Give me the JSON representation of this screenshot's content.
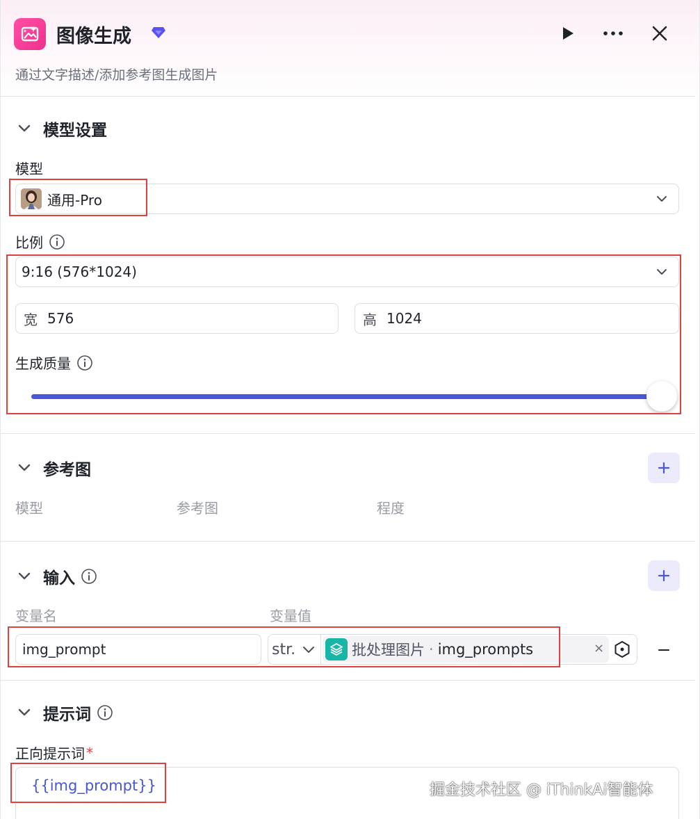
{
  "header": {
    "title": "图像生成",
    "subtitle": "通过文字描述/添加参考图生成图片",
    "app_icon": "image-sparkle-icon",
    "badge_icon": "diamond-icon",
    "actions": [
      "play-icon",
      "more-icon",
      "close-icon"
    ]
  },
  "model_settings": {
    "section_title": "模型设置",
    "model_label": "模型",
    "model_value": "通用-Pro",
    "ratio_label": "比例",
    "ratio_value": "9:16 (576*1024)",
    "width_prefix": "宽",
    "width_value": "576",
    "height_prefix": "高",
    "height_value": "1024",
    "quality_label": "生成质量",
    "quality_level": 1.0
  },
  "reference": {
    "section_title": "参考图",
    "columns": [
      "模型",
      "参考图",
      "程度"
    ]
  },
  "inputs": {
    "section_title": "输入",
    "columns": [
      "变量名",
      "变量值"
    ],
    "rows": [
      {
        "name": "img_prompt",
        "type": "str.",
        "source": "批处理图片",
        "separator": "·",
        "variable": "img_prompts",
        "clear": "×"
      }
    ]
  },
  "prompt": {
    "section_title": "提示词",
    "positive_label": "正向提示词",
    "required_mark": "*",
    "positive_value": "{{img_prompt}}"
  },
  "watermark": "掘金技术社区 @ iThinkAi智能体",
  "colors": {
    "accent": "#4b57d9",
    "brand_pink": "#f0308e",
    "highlight_red": "#e0403f",
    "chip_teal": "#17b6a7",
    "variable_blue": "#4856cf"
  }
}
